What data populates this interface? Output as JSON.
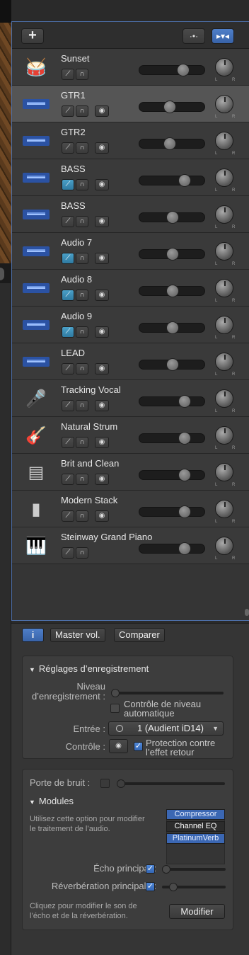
{
  "tracks": [
    {
      "name": "Sunset",
      "icon": "drumkit-icon",
      "sel": false,
      "mute_on": false,
      "rec": false,
      "vol": 0.7
    },
    {
      "name": "GTR1",
      "icon": "audio-wave-icon",
      "sel": true,
      "mute_on": false,
      "rec": true,
      "vol": 0.45
    },
    {
      "name": "GTR2",
      "icon": "audio-wave-icon",
      "sel": false,
      "mute_on": false,
      "rec": true,
      "vol": 0.45
    },
    {
      "name": "BASS",
      "icon": "audio-wave-icon",
      "sel": false,
      "mute_on": true,
      "rec": true,
      "vol": 0.72
    },
    {
      "name": "BASS",
      "icon": "audio-wave-icon",
      "sel": false,
      "mute_on": false,
      "rec": true,
      "vol": 0.5
    },
    {
      "name": "Audio 7",
      "icon": "audio-wave-icon",
      "sel": false,
      "mute_on": true,
      "rec": true,
      "vol": 0.5
    },
    {
      "name": "Audio 8",
      "icon": "audio-wave-icon",
      "sel": false,
      "mute_on": true,
      "rec": true,
      "vol": 0.5
    },
    {
      "name": "Audio 9",
      "icon": "audio-wave-icon",
      "sel": false,
      "mute_on": true,
      "rec": true,
      "vol": 0.5
    },
    {
      "name": "LEAD",
      "icon": "audio-wave-icon",
      "sel": false,
      "mute_on": false,
      "rec": true,
      "vol": 0.5
    },
    {
      "name": "Tracking Vocal",
      "icon": "microphone-icon",
      "sel": false,
      "mute_on": false,
      "rec": true,
      "vol": 0.72
    },
    {
      "name": "Natural Strum",
      "icon": "acoustic-guitar-icon",
      "sel": false,
      "mute_on": false,
      "rec": true,
      "vol": 0.72
    },
    {
      "name": "Brit and Clean",
      "icon": "amp-icon",
      "sel": false,
      "mute_on": false,
      "rec": true,
      "vol": 0.72
    },
    {
      "name": "Modern Stack",
      "icon": "cabinet-icon",
      "sel": false,
      "mute_on": false,
      "rec": true,
      "vol": 0.72
    },
    {
      "name": "Steinway Grand Piano",
      "icon": "piano-icon",
      "sel": false,
      "mute_on": false,
      "rec": false,
      "vol": 0.72
    }
  ],
  "knob_labels": {
    "l": "L",
    "r": "R"
  },
  "panel": {
    "info_label": "i",
    "master_vol": "Master vol.",
    "compare": "Comparer",
    "rec_settings_title": "Réglages d’enregistrement",
    "rec_level_label_1": "Niveau",
    "rec_level_label_2": "d’enregistrement :",
    "auto_level_1": "Contrôle de niveau",
    "auto_level_2": "automatique",
    "input_label": "Entrée :",
    "input_value": "1  (Audient iD14)",
    "monitor_label": "Contrôle :",
    "feedback_1": "Protection contre",
    "feedback_2": "l’effet retour",
    "noise_gate_label": "Porte de bruit :",
    "modules_title": "Modules",
    "modules_hint_1": "Utilisez cette option pour modifier",
    "modules_hint_2": "le traitement de l’audio.",
    "modules": [
      "Compressor",
      "Channel EQ",
      "PlatinumVerb"
    ],
    "echo_label": "Écho principal :",
    "reverb_label": "Réverbération principale :",
    "modify_hint_1": "Cliquez pour modifier le son de",
    "modify_hint_2": "l’écho et de la réverbération.",
    "modify_button": "Modifier"
  }
}
